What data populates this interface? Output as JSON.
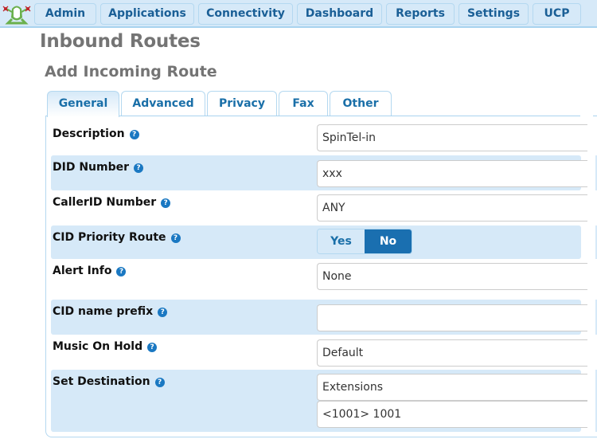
{
  "nav": {
    "logo_icon": "frog-logo-icon",
    "items": [
      {
        "label": "Admin"
      },
      {
        "label": "Applications"
      },
      {
        "label": "Connectivity"
      },
      {
        "label": "Dashboard"
      },
      {
        "label": "Reports"
      },
      {
        "label": "Settings"
      },
      {
        "label": "UCP"
      }
    ]
  },
  "page": {
    "title": "Inbound Routes",
    "subtitle": "Add Incoming Route"
  },
  "tabs": [
    {
      "label": "General",
      "active": true
    },
    {
      "label": "Advanced",
      "active": false
    },
    {
      "label": "Privacy",
      "active": false
    },
    {
      "label": "Fax",
      "active": false
    },
    {
      "label": "Other",
      "active": false
    }
  ],
  "help_glyph": "?",
  "form": {
    "description": {
      "label": "Description",
      "value": "SpinTel-in"
    },
    "did_number": {
      "label": "DID Number",
      "value": "xxx"
    },
    "callerid_number": {
      "label": "CallerID Number",
      "value": "ANY"
    },
    "cid_priority_route": {
      "label": "CID Priority Route",
      "options": [
        "Yes",
        "No"
      ],
      "selected": "No"
    },
    "alert_info": {
      "label": "Alert Info",
      "value": "None"
    },
    "cid_name_prefix": {
      "label": "CID name prefix",
      "value": ""
    },
    "music_on_hold": {
      "label": "Music On Hold",
      "value": "Default"
    },
    "set_destination": {
      "label": "Set Destination",
      "type_value": "Extensions",
      "target_value": "<1001> 1001"
    }
  },
  "colors": {
    "accent": "#1a6fb0",
    "nav_bg": "#d6e9f8",
    "row_shade": "#d6e9f8",
    "title_gray": "#747474"
  }
}
